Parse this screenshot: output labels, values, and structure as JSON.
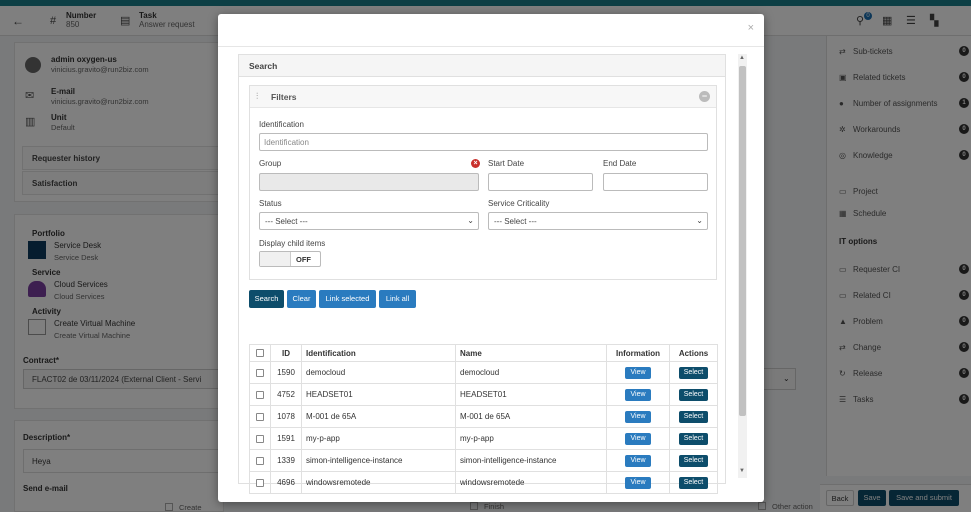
{
  "topbar": {
    "number_label": "Number",
    "number_value": "850",
    "task_label": "Task",
    "task_value": "Answer request",
    "notif_count": "0"
  },
  "requester": {
    "name": "admin oxygen-us",
    "email_short": "vinicius.gravito@run2biz.com",
    "email_label": "E-mail",
    "email_value": "vinicius.gravito@run2biz.com",
    "unit_label": "Unit",
    "unit_value": "Default",
    "history_label": "Requester history",
    "satisfaction_label": "Satisfaction"
  },
  "service_info": {
    "portfolio_label": "Portfolio",
    "portfolio_value": "Service Desk",
    "portfolio_sub": "Service Desk",
    "service_label": "Service",
    "service_value": "Cloud Services",
    "service_sub": "Cloud Services",
    "activity_label": "Activity",
    "activity_value": "Create Virtual Machine",
    "activity_sub": "Create Virtual Machine",
    "contract_label": "Contract*",
    "contract_value": "FLACT02 de 03/11/2024 (External Client - Servi"
  },
  "description": {
    "label": "Description*",
    "value": "Heya",
    "send_email_label": "Send e-mail",
    "opt_create": "Create",
    "opt_finish": "Finish",
    "opt_other": "Other action"
  },
  "right_sidebar": {
    "items": [
      {
        "label": "Sub-tickets",
        "count": "0"
      },
      {
        "label": "Related tickets",
        "count": "0"
      },
      {
        "label": "Number of assignments",
        "count": "1"
      },
      {
        "label": "Workarounds",
        "count": "0"
      },
      {
        "label": "Knowledge",
        "count": "0"
      }
    ],
    "items2": [
      {
        "label": "Project"
      },
      {
        "label": "Schedule"
      }
    ],
    "it_options_label": "IT options",
    "it_items": [
      {
        "label": "Requester CI",
        "count": "0"
      },
      {
        "label": "Related CI",
        "count": "0"
      },
      {
        "label": "Problem",
        "count": "0"
      },
      {
        "label": "Change",
        "count": "0"
      },
      {
        "label": "Release",
        "count": "0"
      },
      {
        "label": "Tasks",
        "count": "0"
      }
    ]
  },
  "bottom_buttons": {
    "back": "Back",
    "save": "Save",
    "save_submit": "Save and submit"
  },
  "modal": {
    "close": "×",
    "search_title": "Search",
    "filters_title": "Filters",
    "identification_label": "Identification",
    "identification_placeholder": "Identification",
    "group_label": "Group",
    "start_date_label": "Start Date",
    "end_date_label": "End Date",
    "status_label": "Status",
    "status_value": "--- Select ---",
    "criticality_label": "Service Criticality",
    "criticality_value": "--- Select ---",
    "child_items_label": "Display child items",
    "toggle_value": "OFF",
    "buttons": {
      "search": "Search",
      "clear": "Clear",
      "link_selected": "Link selected",
      "link_all": "Link all"
    },
    "colors": {
      "search_btn": "#0d4d6b",
      "secondary_btn": "#2a7bbf"
    },
    "table": {
      "headers": {
        "id": "ID",
        "identification": "Identification",
        "name": "Name",
        "information": "Information",
        "actions": "Actions"
      },
      "view_label": "View",
      "select_label": "Select",
      "rows": [
        {
          "id": "1590",
          "identification": "democloud",
          "name": "democloud"
        },
        {
          "id": "4752",
          "identification": "HEADSET01",
          "name": "HEADSET01"
        },
        {
          "id": "1078",
          "identification": "M-001 de 65A",
          "name": "M-001 de 65A"
        },
        {
          "id": "1591",
          "identification": "my-p-app",
          "name": "my-p-app"
        },
        {
          "id": "1339",
          "identification": "simon-intelligence-instance",
          "name": "simon-intelligence-instance"
        },
        {
          "id": "4696",
          "identification": "windowsremotede",
          "name": "windowsremotede"
        }
      ]
    }
  }
}
